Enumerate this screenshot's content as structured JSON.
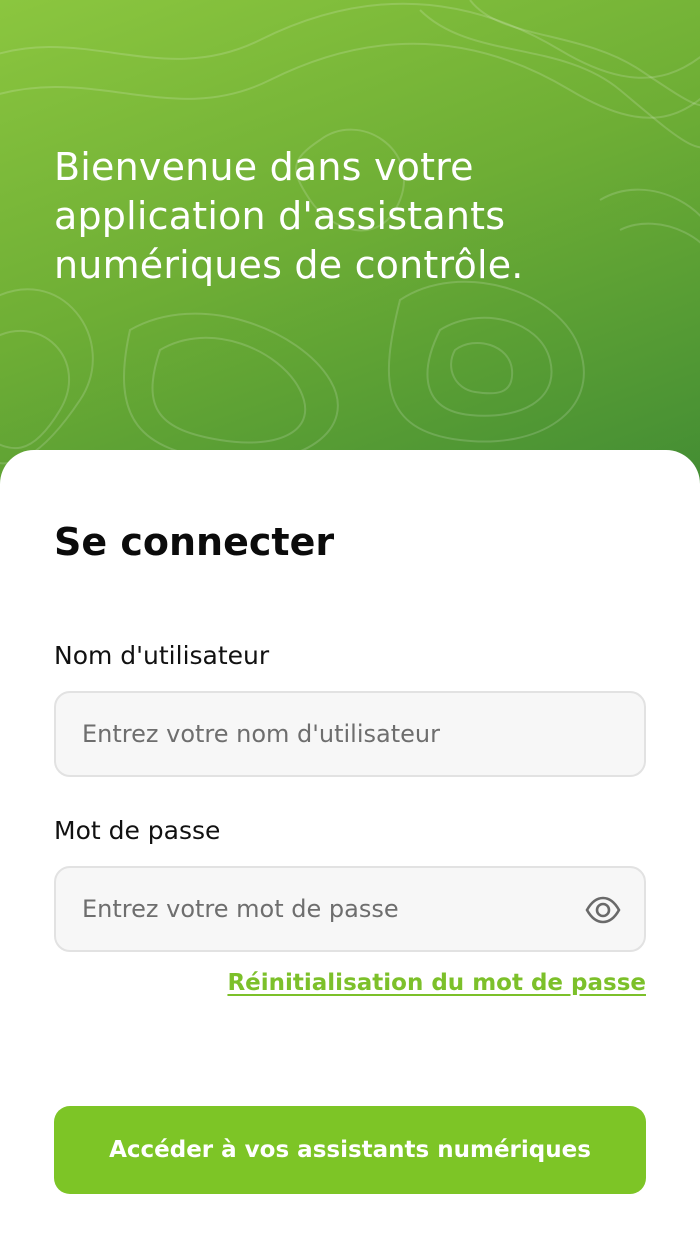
{
  "hero": {
    "title": "Bienvenue dans votre application d'assistants numériques de contrôle."
  },
  "login": {
    "title": "Se connecter",
    "username": {
      "label": "Nom d'utilisateur",
      "placeholder": "Entrez votre nom d'utilisateur",
      "value": ""
    },
    "password": {
      "label": "Mot de passe",
      "placeholder": "Entrez votre mot de passe",
      "value": "",
      "toggle_icon": "eye-icon"
    },
    "reset_link": "Réinitialisation du mot de passe",
    "submit_label": "Accéder à vos assistants numériques"
  },
  "colors": {
    "brand_green": "#7dc526",
    "link_green": "#7cc02a",
    "hero_gradient_start": "#8bc63f",
    "hero_gradient_end": "#3f8a33"
  }
}
